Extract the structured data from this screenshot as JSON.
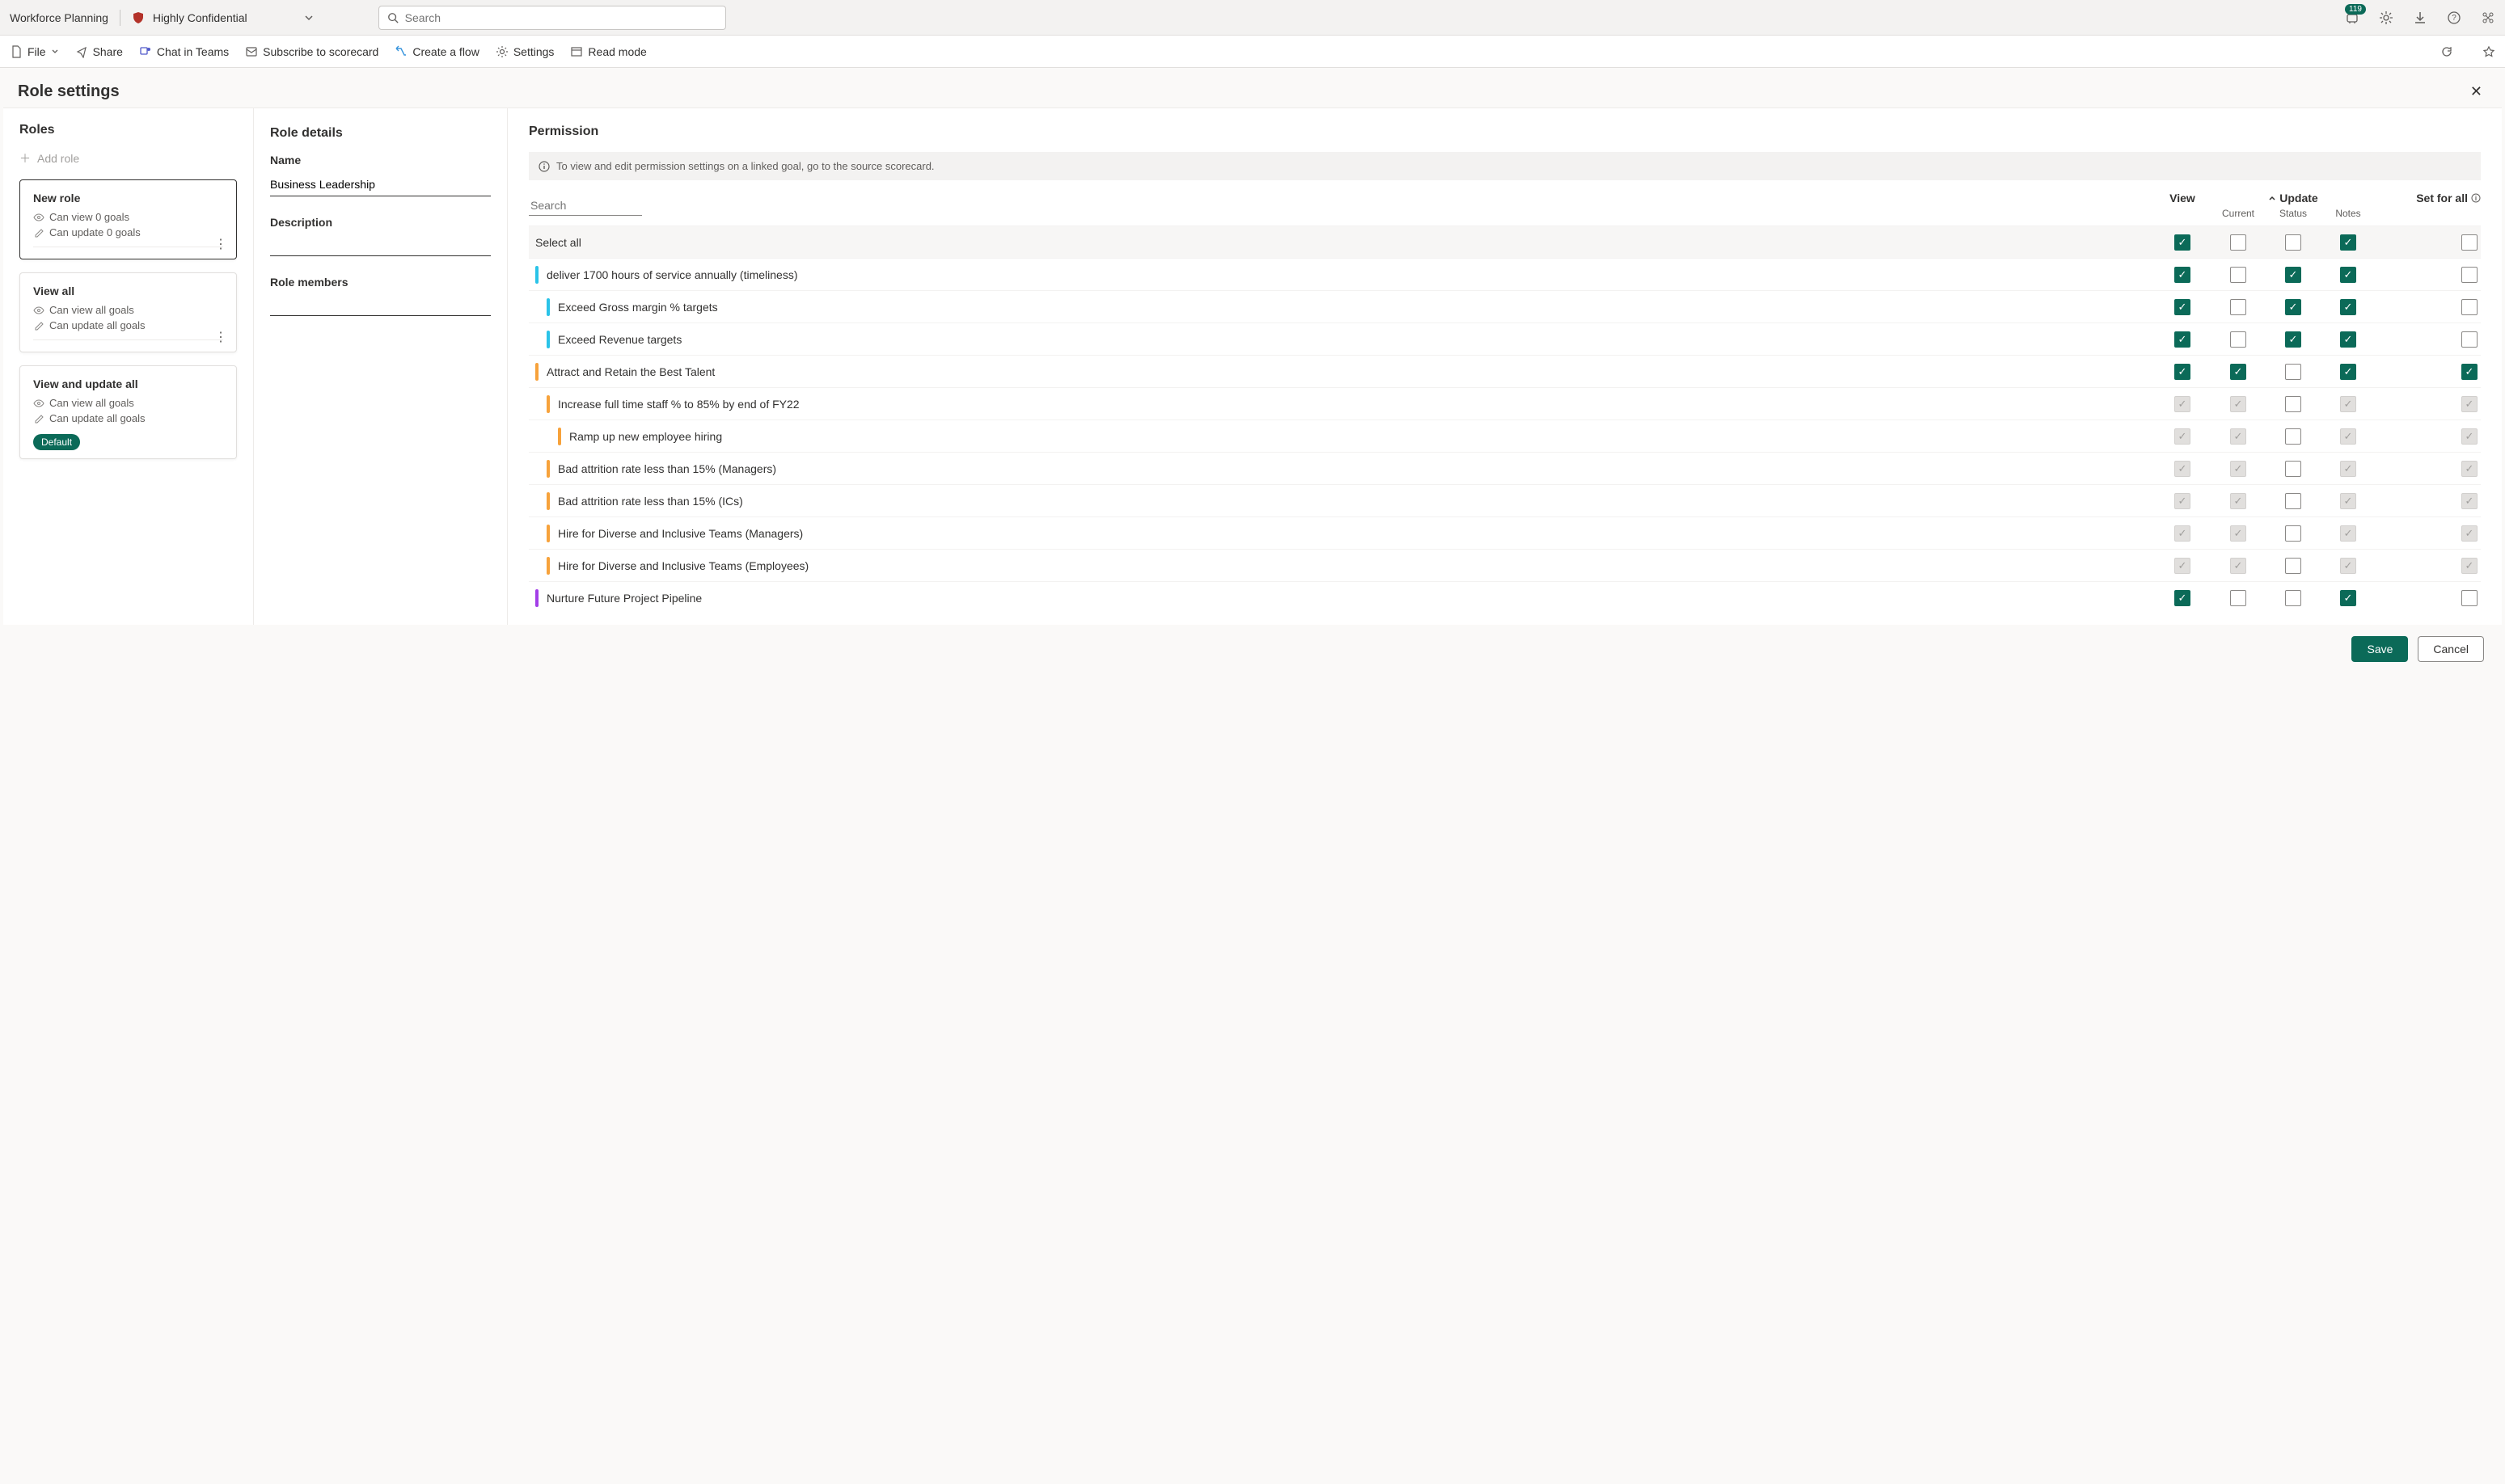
{
  "appbar": {
    "title": "Workforce Planning",
    "sensitivity": "Highly Confidential",
    "search_placeholder": "Search",
    "badge_count": "119"
  },
  "cmdbar": {
    "file": "File",
    "share": "Share",
    "chat": "Chat in Teams",
    "subscribe": "Subscribe to scorecard",
    "flow": "Create a flow",
    "settings": "Settings",
    "read": "Read mode"
  },
  "page": {
    "title": "Role settings"
  },
  "roles": {
    "heading": "Roles",
    "add": "Add role",
    "cards": [
      {
        "title": "New role",
        "line1": "Can view 0 goals",
        "line2": "Can update 0 goals",
        "selected": true,
        "more": true
      },
      {
        "title": "View all",
        "line1": "Can view all goals",
        "line2": "Can update all goals",
        "selected": false,
        "more": true
      },
      {
        "title": "View and update all",
        "line1": "Can view all goals",
        "line2": "Can update all goals",
        "selected": false,
        "default": "Default"
      }
    ]
  },
  "details": {
    "heading": "Role details",
    "name_label": "Name",
    "name_value": "Business Leadership",
    "desc_label": "Description",
    "members_label": "Role members"
  },
  "perm": {
    "heading": "Permission",
    "banner": "To view and edit permission settings on a linked goal, go to the source scorecard.",
    "search_placeholder": "Search",
    "col_view": "View",
    "col_update": "Update",
    "col_current": "Current",
    "col_status": "Status",
    "col_notes": "Notes",
    "col_setall": "Set for all",
    "selectall": "Select all",
    "rows": [
      {
        "label": "Select all",
        "indent": 0,
        "color": "",
        "view": "checked",
        "current": "",
        "status": "",
        "notes": "checked",
        "setall": "",
        "isSelectAll": true
      },
      {
        "label": "deliver 1700 hours of service annually (timeliness)",
        "indent": 0,
        "color": "#2ac3e8",
        "view": "checked",
        "current": "",
        "status": "checked",
        "notes": "checked",
        "setall": ""
      },
      {
        "label": "Exceed Gross margin % targets",
        "indent": 1,
        "color": "#2ac3e8",
        "view": "checked",
        "current": "",
        "status": "checked",
        "notes": "checked",
        "setall": ""
      },
      {
        "label": "Exceed Revenue targets",
        "indent": 1,
        "color": "#2ac3e8",
        "view": "checked",
        "current": "",
        "status": "checked",
        "notes": "checked",
        "setall": ""
      },
      {
        "label": "Attract and Retain the Best Talent",
        "indent": 0,
        "color": "#f7a23b",
        "view": "checked",
        "current": "checked",
        "status": "",
        "notes": "checked",
        "setall": "checked"
      },
      {
        "label": "Increase full time staff % to 85% by end of FY22",
        "indent": 1,
        "color": "#f7a23b",
        "view": "dchecked",
        "current": "dchecked",
        "status": "",
        "notes": "dchecked",
        "setall": "dchecked"
      },
      {
        "label": "Ramp up new employee hiring",
        "indent": 2,
        "color": "#f7a23b",
        "view": "dchecked",
        "current": "dchecked",
        "status": "",
        "notes": "dchecked",
        "setall": "dchecked"
      },
      {
        "label": "Bad attrition rate less than 15% (Managers)",
        "indent": 1,
        "color": "#f7a23b",
        "view": "dchecked",
        "current": "dchecked",
        "status": "",
        "notes": "dchecked",
        "setall": "dchecked"
      },
      {
        "label": "Bad attrition rate less than 15% (ICs)",
        "indent": 1,
        "color": "#f7a23b",
        "view": "dchecked",
        "current": "dchecked",
        "status": "",
        "notes": "dchecked",
        "setall": "dchecked"
      },
      {
        "label": "Hire for Diverse and Inclusive Teams (Managers)",
        "indent": 1,
        "color": "#f7a23b",
        "view": "dchecked",
        "current": "dchecked",
        "status": "",
        "notes": "dchecked",
        "setall": "dchecked"
      },
      {
        "label": "Hire for Diverse and Inclusive Teams (Employees)",
        "indent": 1,
        "color": "#f7a23b",
        "view": "dchecked",
        "current": "dchecked",
        "status": "",
        "notes": "dchecked",
        "setall": "dchecked"
      },
      {
        "label": "Nurture Future Project Pipeline",
        "indent": 0,
        "color": "#a33ee8",
        "view": "checked",
        "current": "",
        "status": "",
        "notes": "checked",
        "setall": ""
      }
    ]
  },
  "footer": {
    "save": "Save",
    "cancel": "Cancel"
  }
}
